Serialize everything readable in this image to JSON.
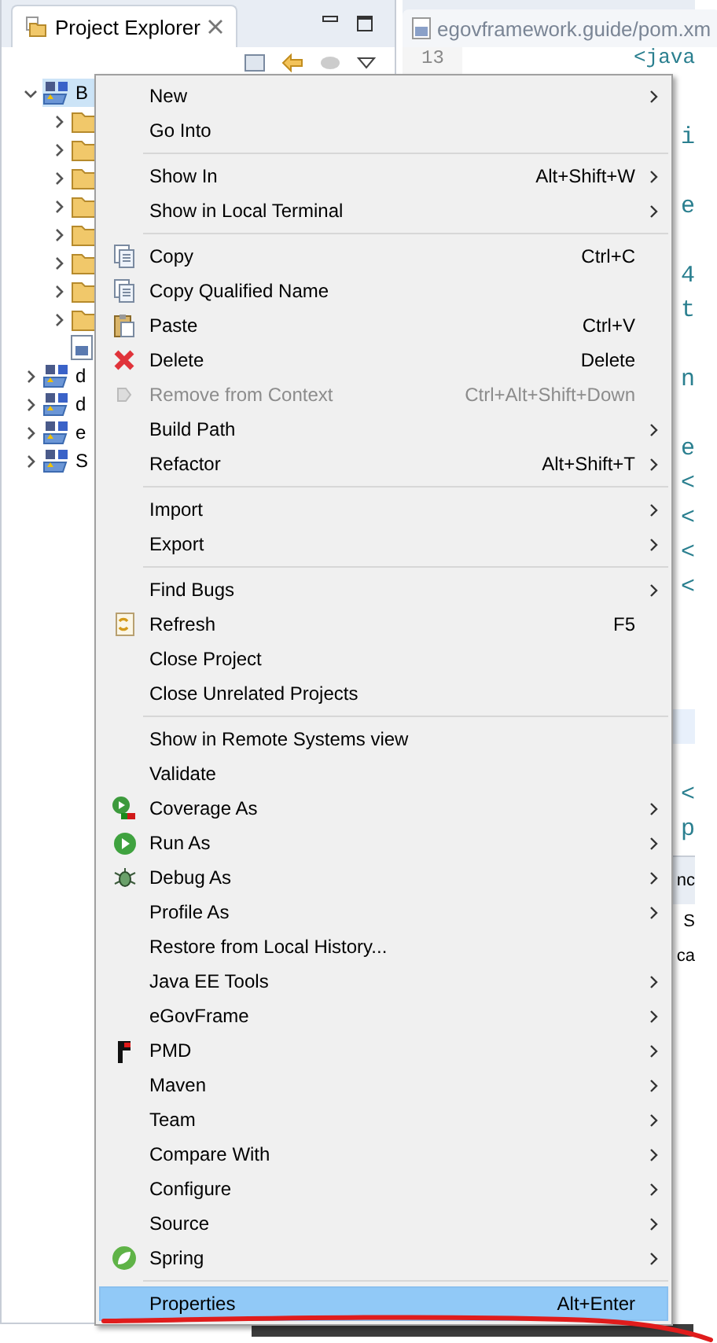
{
  "explorer": {
    "title": "Project Explorer",
    "tree": [
      {
        "label": "B",
        "expanded": true,
        "selected": true,
        "children": [
          {
            "kind": "folder",
            "expanded": false
          },
          {
            "kind": "folder",
            "expanded": false
          },
          {
            "kind": "folder",
            "expanded": false
          },
          {
            "kind": "folder",
            "expanded": false
          },
          {
            "kind": "folder",
            "expanded": false
          },
          {
            "kind": "folder",
            "expanded": false
          },
          {
            "kind": "folder",
            "expanded": false
          },
          {
            "kind": "folder",
            "expanded": false
          },
          {
            "kind": "file"
          }
        ]
      },
      {
        "label": "d",
        "expanded": false,
        "selected": false
      },
      {
        "label": "d",
        "expanded": false,
        "selected": false
      },
      {
        "label": "e",
        "expanded": false,
        "selected": false
      },
      {
        "label": "S",
        "expanded": false,
        "selected": false
      }
    ]
  },
  "editor": {
    "tab": "egovframework.guide/pom.xm",
    "line_number": "13",
    "lines": [
      {
        "kind": "text",
        "text": "<java"
      },
      {
        "kind": "blank"
      },
      {
        "kind": "text",
        "text": "i"
      },
      {
        "kind": "blank"
      },
      {
        "kind": "text",
        "text": "e"
      },
      {
        "kind": "blank"
      },
      {
        "kind": "text",
        "text": "4"
      },
      {
        "kind": "text",
        "text": "t"
      },
      {
        "kind": "blank"
      },
      {
        "kind": "text",
        "text": "n"
      },
      {
        "kind": "blank"
      },
      {
        "kind": "text",
        "text": "e"
      },
      {
        "kind": "text",
        "text": "<"
      },
      {
        "kind": "text",
        "text": "<"
      },
      {
        "kind": "text",
        "text": "<"
      },
      {
        "kind": "text",
        "text": "<"
      },
      {
        "kind": "blank"
      },
      {
        "kind": "blank"
      },
      {
        "kind": "blank"
      },
      {
        "kind": "current"
      },
      {
        "kind": "blank"
      },
      {
        "kind": "text",
        "text": "<"
      },
      {
        "kind": "text",
        "text": "p"
      }
    ]
  },
  "lower_panel": {
    "tab": "nc",
    "lines": [
      "S",
      "ca"
    ]
  },
  "menu": {
    "items": [
      {
        "kind": "item",
        "label": "New",
        "submenu": true,
        "disabled": false,
        "selected": false
      },
      {
        "kind": "item",
        "label": "Go Into",
        "submenu": false,
        "disabled": false,
        "selected": false
      },
      {
        "kind": "separator"
      },
      {
        "kind": "item",
        "label": "Show In",
        "shortcut": "Alt+Shift+W",
        "submenu": true,
        "disabled": false,
        "selected": false
      },
      {
        "kind": "item",
        "label": "Show in Local Terminal",
        "submenu": true,
        "disabled": false,
        "selected": false
      },
      {
        "kind": "separator"
      },
      {
        "kind": "item",
        "label": "Copy",
        "shortcut": "Ctrl+C",
        "submenu": false,
        "disabled": false,
        "selected": false
      },
      {
        "kind": "item",
        "label": "Copy Qualified Name",
        "submenu": false,
        "disabled": false,
        "selected": false
      },
      {
        "kind": "item",
        "label": "Paste",
        "shortcut": "Ctrl+V",
        "submenu": false,
        "disabled": false,
        "selected": false
      },
      {
        "kind": "item",
        "label": "Delete",
        "shortcut": "Delete",
        "submenu": false,
        "disabled": false,
        "selected": false
      },
      {
        "kind": "item",
        "label": "Remove from Context",
        "shortcut": "Ctrl+Alt+Shift+Down",
        "submenu": false,
        "disabled": true,
        "selected": false
      },
      {
        "kind": "item",
        "label": "Build Path",
        "submenu": true,
        "disabled": false,
        "selected": false
      },
      {
        "kind": "item",
        "label": "Refactor",
        "shortcut": "Alt+Shift+T",
        "submenu": true,
        "disabled": false,
        "selected": false
      },
      {
        "kind": "separator"
      },
      {
        "kind": "item",
        "label": "Import",
        "submenu": true,
        "disabled": false,
        "selected": false
      },
      {
        "kind": "item",
        "label": "Export",
        "submenu": true,
        "disabled": false,
        "selected": false
      },
      {
        "kind": "separator"
      },
      {
        "kind": "item",
        "label": "Find Bugs",
        "submenu": true,
        "disabled": false,
        "selected": false
      },
      {
        "kind": "item",
        "label": "Refresh",
        "shortcut": "F5",
        "submenu": false,
        "disabled": false,
        "selected": false
      },
      {
        "kind": "item",
        "label": "Close Project",
        "submenu": false,
        "disabled": false,
        "selected": false
      },
      {
        "kind": "item",
        "label": "Close Unrelated Projects",
        "submenu": false,
        "disabled": false,
        "selected": false
      },
      {
        "kind": "separator"
      },
      {
        "kind": "item",
        "label": "Show in Remote Systems view",
        "submenu": false,
        "disabled": false,
        "selected": false
      },
      {
        "kind": "item",
        "label": "Validate",
        "submenu": false,
        "disabled": false,
        "selected": false
      },
      {
        "kind": "item",
        "label": "Coverage As",
        "submenu": true,
        "disabled": false,
        "selected": false
      },
      {
        "kind": "item",
        "label": "Run As",
        "submenu": true,
        "disabled": false,
        "selected": false
      },
      {
        "kind": "item",
        "label": "Debug As",
        "submenu": true,
        "disabled": false,
        "selected": false
      },
      {
        "kind": "item",
        "label": "Profile As",
        "submenu": true,
        "disabled": false,
        "selected": false
      },
      {
        "kind": "item",
        "label": "Restore from Local History...",
        "submenu": false,
        "disabled": false,
        "selected": false
      },
      {
        "kind": "item",
        "label": "Java EE Tools",
        "submenu": true,
        "disabled": false,
        "selected": false
      },
      {
        "kind": "item",
        "label": "eGovFrame",
        "submenu": true,
        "disabled": false,
        "selected": false
      },
      {
        "kind": "item",
        "label": "PMD",
        "submenu": true,
        "disabled": false,
        "selected": false
      },
      {
        "kind": "item",
        "label": "Maven",
        "submenu": true,
        "disabled": false,
        "selected": false
      },
      {
        "kind": "item",
        "label": "Team",
        "submenu": true,
        "disabled": false,
        "selected": false
      },
      {
        "kind": "item",
        "label": "Compare With",
        "submenu": true,
        "disabled": false,
        "selected": false
      },
      {
        "kind": "item",
        "label": "Configure",
        "submenu": true,
        "disabled": false,
        "selected": false
      },
      {
        "kind": "item",
        "label": "Source",
        "submenu": true,
        "disabled": false,
        "selected": false
      },
      {
        "kind": "item",
        "label": "Spring",
        "submenu": true,
        "disabled": false,
        "selected": false
      },
      {
        "kind": "separator"
      },
      {
        "kind": "item",
        "label": "Properties",
        "shortcut": "Alt+Enter",
        "submenu": false,
        "disabled": false,
        "selected": true
      }
    ]
  }
}
